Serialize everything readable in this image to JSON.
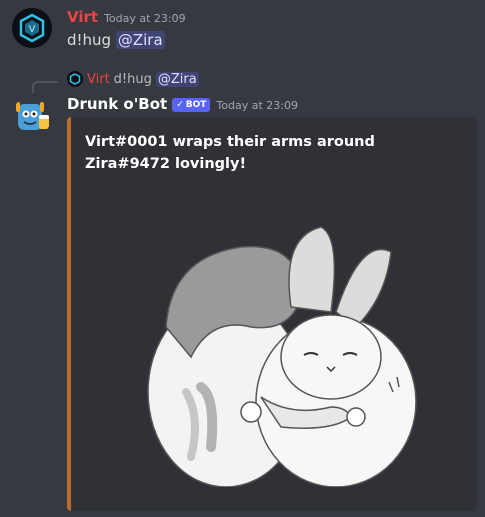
{
  "message1": {
    "username": "Virt",
    "username_color": "#ed4245",
    "timestamp": "Today at 23:09",
    "command": "d!hug",
    "mention": "@Zira"
  },
  "reply": {
    "username": "Virt",
    "command": "d!hug",
    "mention": "@Zira"
  },
  "message2": {
    "username": "Drunk o'Bot",
    "bot_tag": "BOT",
    "timestamp": "Today at 23:09",
    "embed": {
      "description": "Virt#0001 wraps their arms around Zira#9472 lovingly!",
      "border_color": "#b86b2e",
      "image": "bunnies-hugging-illustration"
    }
  }
}
